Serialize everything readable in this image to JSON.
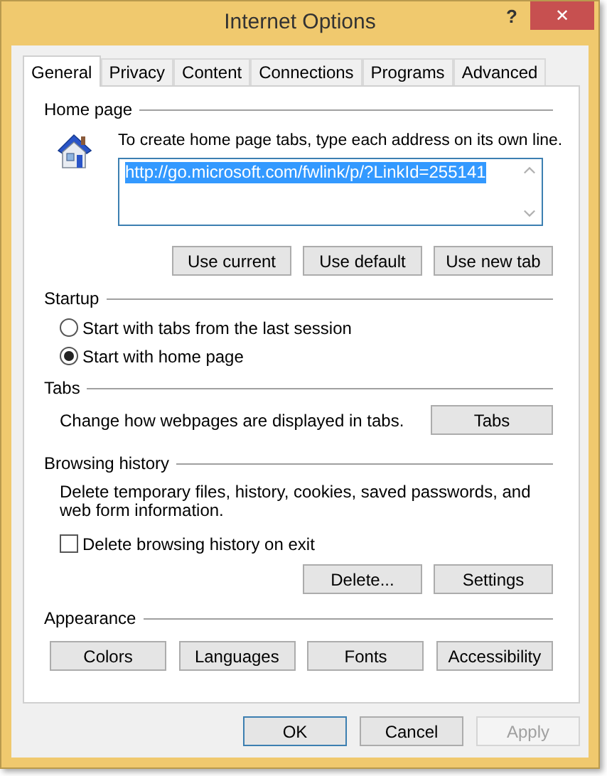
{
  "window": {
    "title": "Internet Options",
    "help": "?",
    "close": "✕"
  },
  "tabs": [
    {
      "label": "General",
      "selected": true
    },
    {
      "label": "Privacy",
      "selected": false
    },
    {
      "label": "Content",
      "selected": false
    },
    {
      "label": "Connections",
      "selected": false
    },
    {
      "label": "Programs",
      "selected": false
    },
    {
      "label": "Advanced",
      "selected": false
    }
  ],
  "home_page": {
    "heading": "Home page",
    "instruction": "To create home page tabs, type each address on its own line.",
    "value": "http://go.microsoft.com/fwlink/p/?LinkId=255141",
    "buttons": [
      "Use current",
      "Use default",
      "Use new tab"
    ]
  },
  "startup": {
    "heading": "Startup",
    "options": [
      {
        "label": "Start with tabs from the last session",
        "selected": false
      },
      {
        "label": "Start with home page",
        "selected": true
      }
    ]
  },
  "tabs_section": {
    "heading": "Tabs",
    "description": "Change how webpages are displayed in tabs.",
    "button": "Tabs"
  },
  "browsing_history": {
    "heading": "Browsing history",
    "description": "Delete temporary files, history, cookies, saved passwords, and web form information.",
    "checkbox": {
      "label": "Delete browsing history on exit",
      "checked": false
    },
    "buttons": [
      "Delete...",
      "Settings"
    ]
  },
  "appearance": {
    "heading": "Appearance",
    "buttons": [
      "Colors",
      "Languages",
      "Fonts",
      "Accessibility"
    ]
  },
  "footer_buttons": [
    {
      "label": "OK",
      "default": true,
      "disabled": false
    },
    {
      "label": "Cancel",
      "default": false,
      "disabled": false
    },
    {
      "label": "Apply",
      "default": false,
      "disabled": true
    }
  ]
}
